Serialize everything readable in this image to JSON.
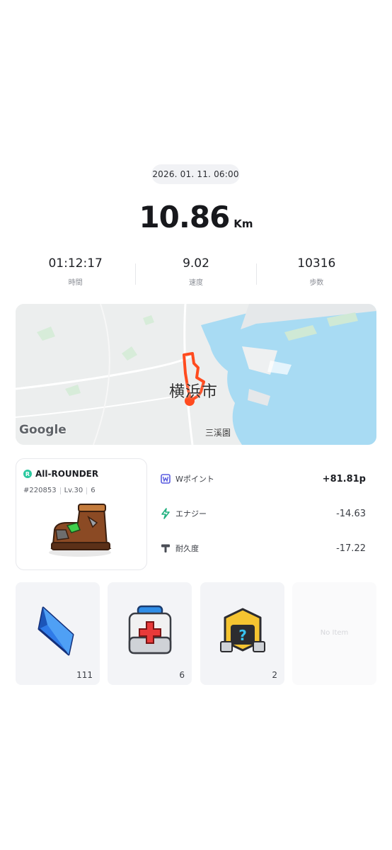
{
  "record": {
    "date": "2026. 01. 11. 06:00",
    "distance_value": "10.86",
    "distance_unit": "Km"
  },
  "stats": [
    {
      "value": "01:12:17",
      "label": "時間"
    },
    {
      "value": "9.02",
      "label": "速度"
    },
    {
      "value": "10316",
      "label": "歩数"
    }
  ],
  "map": {
    "city_label": "横浜市",
    "area_label": "三溪園",
    "provider_logo": "Google",
    "route_color": "#ff4b1f"
  },
  "character": {
    "badge": "R",
    "name": "All-ROUNDER",
    "id": "#220853",
    "level": "Lv.30",
    "mint_icon": "6",
    "image": "boot-sneaker-icon"
  },
  "points": [
    {
      "icon": "w-point-icon",
      "label": "Wポイント",
      "value": "+81.81p"
    },
    {
      "icon": "energy-bolt-icon",
      "label": "エナジー",
      "value": "-14.63"
    },
    {
      "icon": "hammer-durability-icon",
      "label": "耐久度",
      "value": "-17.22"
    }
  ],
  "items": [
    {
      "icon": "blue-gem-icon",
      "count": "111"
    },
    {
      "icon": "first-aid-kit-icon",
      "count": "6"
    },
    {
      "icon": "mystery-box-icon",
      "count": "2"
    },
    {
      "icon": "",
      "count": "",
      "empty_label": "No Item"
    }
  ],
  "colors": {
    "accent_green": "#2bc9a0",
    "route_orange": "#ff4b1f",
    "sea_blue": "#a8dbf3"
  }
}
